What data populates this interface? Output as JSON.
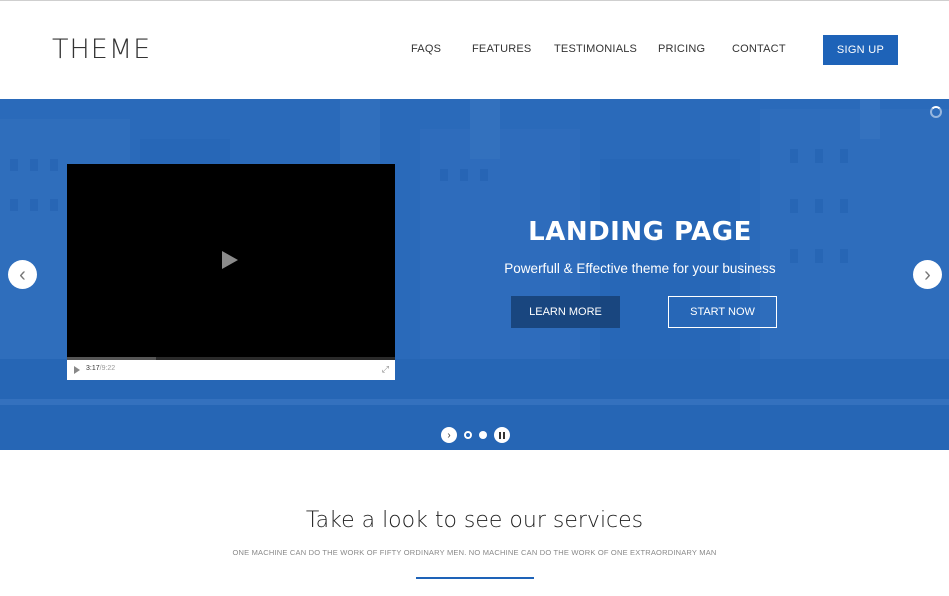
{
  "colors": {
    "accent": "#1e63b8",
    "hero_overlay": "#1f63b8",
    "learn_more_bg": "#19467f",
    "text_dark": "#333333"
  },
  "header": {
    "logo": "THEME",
    "nav": [
      {
        "label": "FAQS"
      },
      {
        "label": "FEATURES"
      },
      {
        "label": "TESTIMONIALS"
      },
      {
        "label": "PRICING"
      },
      {
        "label": "CONTACT"
      }
    ],
    "signup_label": "SIGN UP"
  },
  "hero": {
    "title": "LANDING PAGE",
    "subtitle": "Powerfull & Effective theme for your business",
    "learn_more_label": "LEARN MORE",
    "start_now_label": "START NOW",
    "prev_icon": "chevron-left-icon",
    "next_icon": "chevron-right-icon",
    "slides_total": 2,
    "slide_active": 1
  },
  "video": {
    "current_time": "3:17",
    "duration": "/9:22",
    "progress": 0.27,
    "icons": [
      "play-icon",
      "fullscreen-icon"
    ]
  },
  "services": {
    "title": "Take a look to see our services",
    "subtitle": "ONE MACHINE CAN DO THE WORK OF FIFTY ORDINARY MEN. NO MACHINE CAN DO THE WORK OF ONE EXTRAORDINARY MAN"
  }
}
